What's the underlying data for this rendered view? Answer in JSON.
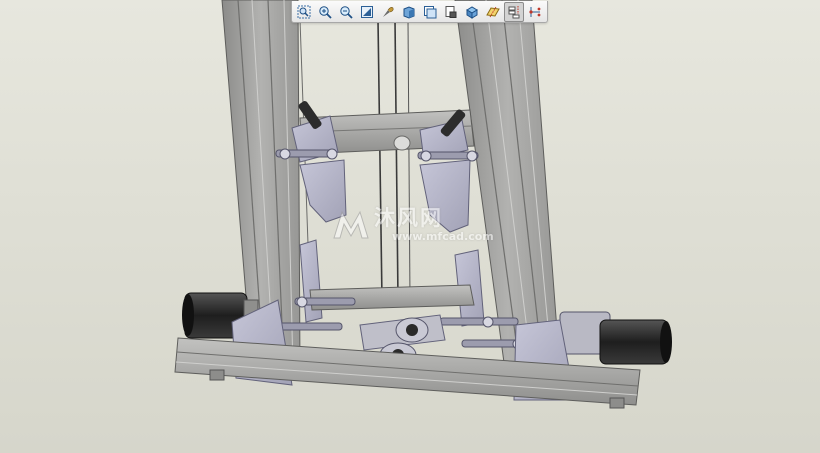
{
  "toolbar": {
    "buttons": [
      {
        "icon": "zoom-window-icon"
      },
      {
        "icon": "zoom-in-icon"
      },
      {
        "icon": "zoom-out-icon"
      },
      {
        "icon": "refit-icon"
      },
      {
        "icon": "spin-center-icon"
      },
      {
        "icon": "shading-icon"
      },
      {
        "icon": "saved-views-icon"
      },
      {
        "icon": "layers-icon"
      },
      {
        "icon": "view-manager-icon"
      },
      {
        "icon": "datum-planes-icon"
      },
      {
        "icon": "datum-axes-icon"
      },
      {
        "icon": "datum-points-icon"
      }
    ],
    "active_index": 10
  },
  "watermark": {
    "text": "沐风网",
    "url": "www.mfcad.com"
  },
  "colors": {
    "background_top": "#e7e7de",
    "background_bottom": "#d6d6cb",
    "frame_metal": "#a6a6a4",
    "bracket_purple": "#b2b2c6",
    "motor_black": "#2b2b2b"
  }
}
